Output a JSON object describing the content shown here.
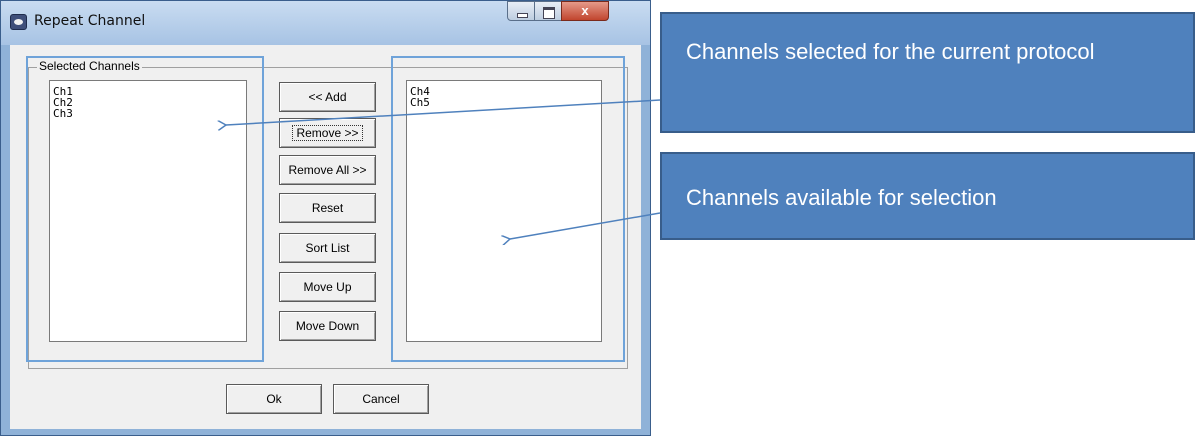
{
  "window": {
    "title": "Repeat Channel",
    "controls": {
      "minimize": "minimize",
      "maximize": "maximize",
      "close": "x"
    }
  },
  "dialog": {
    "group_label": "Selected Channels",
    "selected_list": [
      "Ch1",
      "Ch2",
      "Ch3"
    ],
    "available_list": [
      "Ch4",
      "Ch5"
    ],
    "buttons": {
      "add": "<< Add",
      "remove": "Remove >>",
      "remove_all": "Remove All >>",
      "reset": "Reset",
      "sort_list": "Sort List",
      "move_up": "Move Up",
      "move_down": "Move Down"
    },
    "ok": "Ok",
    "cancel": "Cancel"
  },
  "annotations": {
    "selected_callout": "Channels selected for the current protocol",
    "available_callout": "Channels available for selection",
    "highlight_color": "#6fa3d9",
    "callout_color": "#4f81bd",
    "arrow_color": "#4f81bd"
  }
}
